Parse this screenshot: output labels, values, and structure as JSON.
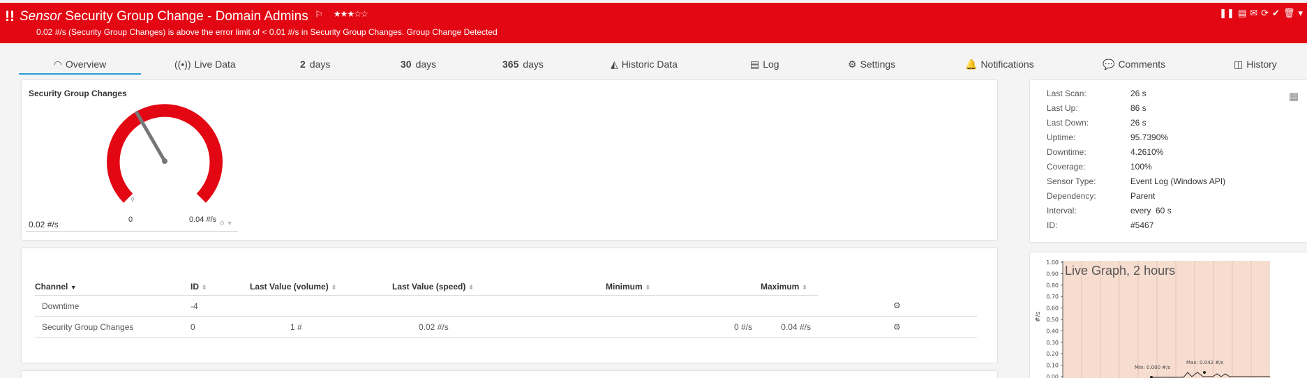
{
  "header": {
    "alert_icon": "!!",
    "sensor_label": "Sensor",
    "title": "Security Group Change - Domain Admins",
    "flag_icon": "flag-icon",
    "stars": "★★★☆☆",
    "message": "0.02 #/s (Security Group Changes) is above the error limit of < 0.01 #/s in Security Group Changes. Group Change Detected",
    "bg_color": "#e30613",
    "tools": [
      "pause-icon",
      "report-icon",
      "email-icon",
      "refresh-icon",
      "acknowledge-icon",
      "delete-icon",
      "dropdown-icon"
    ]
  },
  "tabs": {
    "overview": "Overview",
    "live_data": "Live Data",
    "days2_num": "2",
    "days2_label": "days",
    "days30_num": "30",
    "days30_label": "days",
    "days365_num": "365",
    "days365_label": "days",
    "historic_data": "Historic Data",
    "log": "Log",
    "settings": "Settings",
    "notifications": "Notifications",
    "comments": "Comments",
    "history": "History"
  },
  "gauge": {
    "title": "Security Group Changes",
    "value_label": "0.02 #/s",
    "min_label": "0",
    "max_label": "0.04 #/s",
    "value": 0.02,
    "min": 0,
    "max": 0.04,
    "color": "#e30613"
  },
  "channels": {
    "headers": [
      "Channel",
      "ID",
      "Last Value (volume)",
      "Last Value (speed)",
      "Minimum",
      "Maximum"
    ],
    "rows": [
      {
        "channel": "Downtime",
        "id": "-4",
        "volume": "",
        "speed": "",
        "minimum": "",
        "maximum": ""
      },
      {
        "channel": "Security Group Changes",
        "id": "0",
        "volume": "1 #",
        "speed": "0.02 #/s",
        "minimum": "0 #/s",
        "maximum": "0.04 #/s"
      }
    ]
  },
  "info": {
    "rows": [
      {
        "k": "Last Scan:",
        "v": "26 s"
      },
      {
        "k": "Last Up:",
        "v": "86 s"
      },
      {
        "k": "Last Down:",
        "v": "26 s"
      },
      {
        "k": "Uptime:",
        "v": "95.7390%"
      },
      {
        "k": "Downtime:",
        "v": "4.2610%"
      },
      {
        "k": "Coverage:",
        "v": "100%"
      },
      {
        "k": "Sensor Type:",
        "v": "Event Log (Windows API)"
      },
      {
        "k": "Dependency:",
        "v": "Parent"
      },
      {
        "k": "Interval:",
        "v": "every  60 s"
      },
      {
        "k": "ID:",
        "v": "#5467"
      }
    ]
  },
  "live_graph": {
    "title": "Live Graph, 2 hours",
    "ylabel": "#/s",
    "yticks": [
      "1.00",
      "0.90",
      "0.80",
      "0.70",
      "0.60",
      "0.50",
      "0.40",
      "0.30",
      "0.20",
      "0.10",
      "0.00"
    ],
    "min_label": "Min: 0.000 #/s",
    "max_label": "Max: 0.042 #/s",
    "bg_color": "#f6ddd0"
  }
}
